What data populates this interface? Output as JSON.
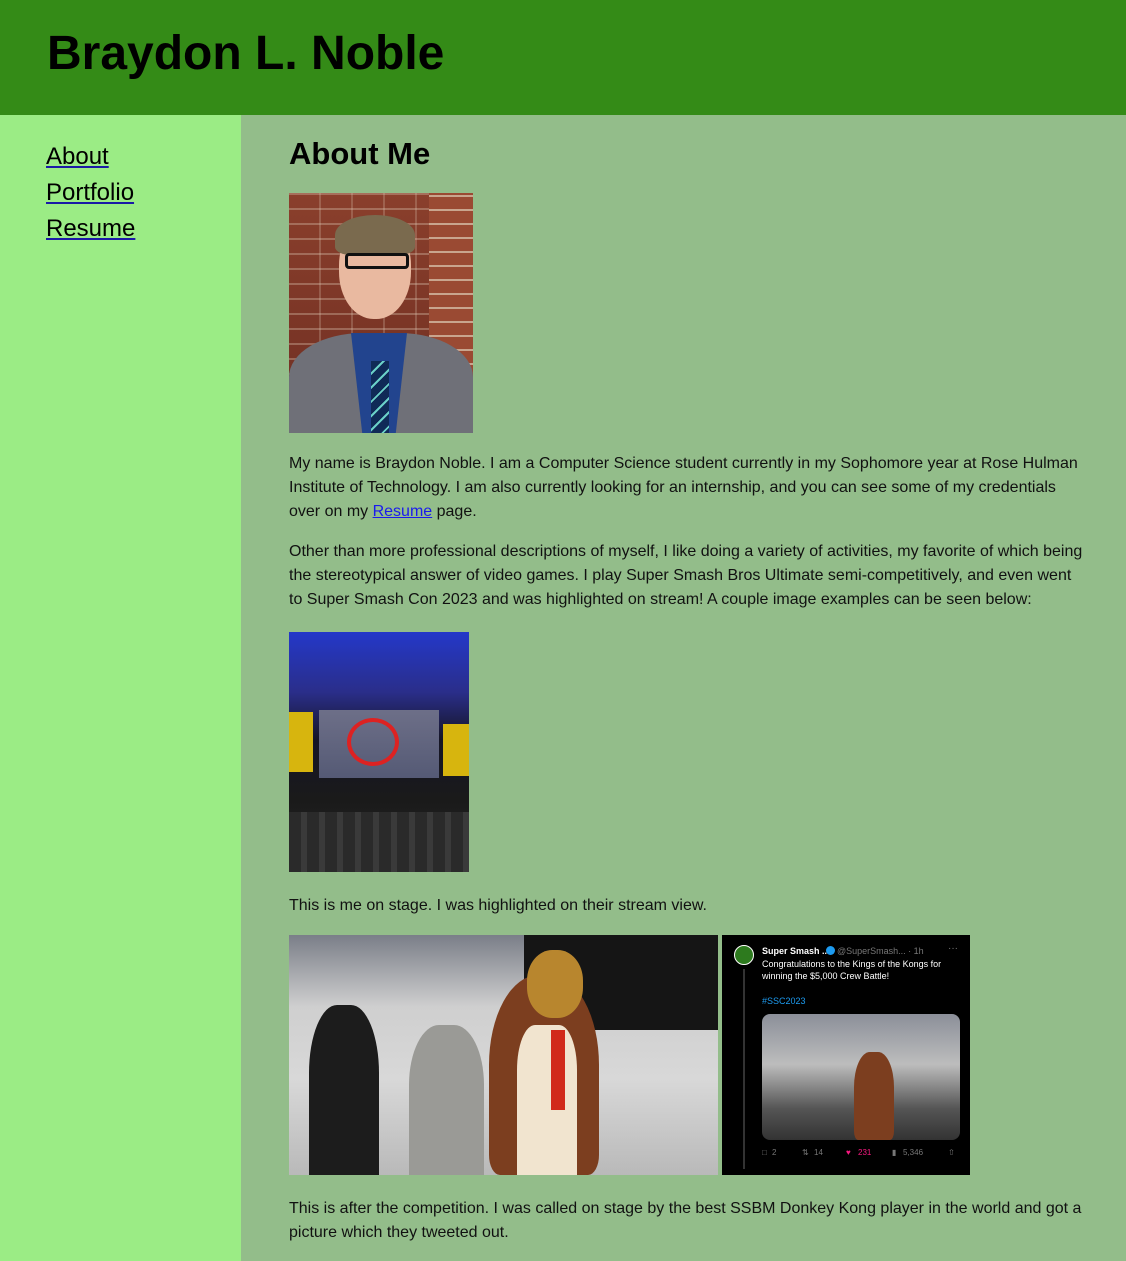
{
  "header": {
    "title": "Braydon L. Noble"
  },
  "nav": {
    "items": [
      {
        "label": "About"
      },
      {
        "label": "Portfolio"
      },
      {
        "label": "Resume"
      }
    ]
  },
  "main": {
    "heading": "About Me",
    "para1_before": "My name is Braydon Noble. I am a Computer Science student currently in my Sophomore year at Rose Hulman Institute of Technology. I am also currently looking for an internship, and you can see some of my credentials over on my ",
    "para1_link": "Resume",
    "para1_after": " page.",
    "para2": "Other than more professional descriptions of myself, I like doing a variety of activities, my favorite of which being the stereotypical answer of video games. I play Super Smash Bros Ultimate semi-competitively, and even went to Super Smash Con 2023 and was highlighted on stream! A couple image examples can be seen below:",
    "caption1": "This is me on stage. I was highlighted on their stream view.",
    "caption2": "This is after the competition. I was called on stage by the best SSBM Donkey Kong player in the world and got a picture which they tweeted out."
  },
  "tweet": {
    "name": "Super Smash ...",
    "handle": "@SuperSmash... · 1h",
    "more": "···",
    "text": "Congratulations to the Kings of the Kongs for winning the $5,000 Crew Battle!",
    "hashtag": "#SSC2023",
    "replies": "2",
    "retweets": "14",
    "likes": "231",
    "views": "5,346"
  },
  "colors": {
    "header_bg": "#348b17",
    "sidebar_bg": "#9bec85",
    "main_bg": "#93bd8a",
    "link": "#1a1aee"
  },
  "icons": [
    "verified-badge-icon",
    "reply-icon",
    "retweet-icon",
    "heart-icon",
    "views-icon",
    "share-icon"
  ]
}
